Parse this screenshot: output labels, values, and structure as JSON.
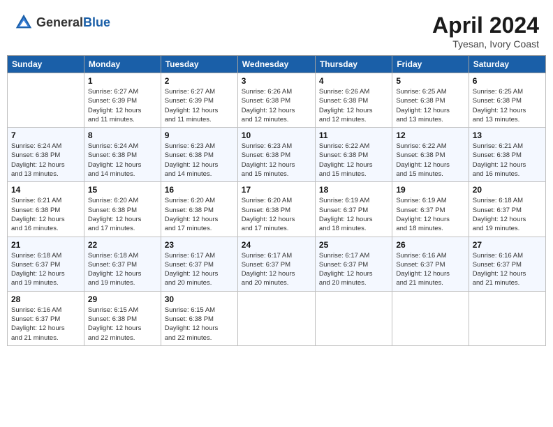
{
  "header": {
    "logo_general": "General",
    "logo_blue": "Blue",
    "month_title": "April 2024",
    "subtitle": "Tyesan, Ivory Coast"
  },
  "days_of_week": [
    "Sunday",
    "Monday",
    "Tuesday",
    "Wednesday",
    "Thursday",
    "Friday",
    "Saturday"
  ],
  "weeks": [
    [
      {
        "day": "",
        "info": ""
      },
      {
        "day": "1",
        "info": "Sunrise: 6:27 AM\nSunset: 6:39 PM\nDaylight: 12 hours\nand 11 minutes."
      },
      {
        "day": "2",
        "info": "Sunrise: 6:27 AM\nSunset: 6:39 PM\nDaylight: 12 hours\nand 11 minutes."
      },
      {
        "day": "3",
        "info": "Sunrise: 6:26 AM\nSunset: 6:38 PM\nDaylight: 12 hours\nand 12 minutes."
      },
      {
        "day": "4",
        "info": "Sunrise: 6:26 AM\nSunset: 6:38 PM\nDaylight: 12 hours\nand 12 minutes."
      },
      {
        "day": "5",
        "info": "Sunrise: 6:25 AM\nSunset: 6:38 PM\nDaylight: 12 hours\nand 13 minutes."
      },
      {
        "day": "6",
        "info": "Sunrise: 6:25 AM\nSunset: 6:38 PM\nDaylight: 12 hours\nand 13 minutes."
      }
    ],
    [
      {
        "day": "7",
        "info": "Sunrise: 6:24 AM\nSunset: 6:38 PM\nDaylight: 12 hours\nand 13 minutes."
      },
      {
        "day": "8",
        "info": "Sunrise: 6:24 AM\nSunset: 6:38 PM\nDaylight: 12 hours\nand 14 minutes."
      },
      {
        "day": "9",
        "info": "Sunrise: 6:23 AM\nSunset: 6:38 PM\nDaylight: 12 hours\nand 14 minutes."
      },
      {
        "day": "10",
        "info": "Sunrise: 6:23 AM\nSunset: 6:38 PM\nDaylight: 12 hours\nand 15 minutes."
      },
      {
        "day": "11",
        "info": "Sunrise: 6:22 AM\nSunset: 6:38 PM\nDaylight: 12 hours\nand 15 minutes."
      },
      {
        "day": "12",
        "info": "Sunrise: 6:22 AM\nSunset: 6:38 PM\nDaylight: 12 hours\nand 15 minutes."
      },
      {
        "day": "13",
        "info": "Sunrise: 6:21 AM\nSunset: 6:38 PM\nDaylight: 12 hours\nand 16 minutes."
      }
    ],
    [
      {
        "day": "14",
        "info": "Sunrise: 6:21 AM\nSunset: 6:38 PM\nDaylight: 12 hours\nand 16 minutes."
      },
      {
        "day": "15",
        "info": "Sunrise: 6:20 AM\nSunset: 6:38 PM\nDaylight: 12 hours\nand 17 minutes."
      },
      {
        "day": "16",
        "info": "Sunrise: 6:20 AM\nSunset: 6:38 PM\nDaylight: 12 hours\nand 17 minutes."
      },
      {
        "day": "17",
        "info": "Sunrise: 6:20 AM\nSunset: 6:38 PM\nDaylight: 12 hours\nand 17 minutes."
      },
      {
        "day": "18",
        "info": "Sunrise: 6:19 AM\nSunset: 6:37 PM\nDaylight: 12 hours\nand 18 minutes."
      },
      {
        "day": "19",
        "info": "Sunrise: 6:19 AM\nSunset: 6:37 PM\nDaylight: 12 hours\nand 18 minutes."
      },
      {
        "day": "20",
        "info": "Sunrise: 6:18 AM\nSunset: 6:37 PM\nDaylight: 12 hours\nand 19 minutes."
      }
    ],
    [
      {
        "day": "21",
        "info": "Sunrise: 6:18 AM\nSunset: 6:37 PM\nDaylight: 12 hours\nand 19 minutes."
      },
      {
        "day": "22",
        "info": "Sunrise: 6:18 AM\nSunset: 6:37 PM\nDaylight: 12 hours\nand 19 minutes."
      },
      {
        "day": "23",
        "info": "Sunrise: 6:17 AM\nSunset: 6:37 PM\nDaylight: 12 hours\nand 20 minutes."
      },
      {
        "day": "24",
        "info": "Sunrise: 6:17 AM\nSunset: 6:37 PM\nDaylight: 12 hours\nand 20 minutes."
      },
      {
        "day": "25",
        "info": "Sunrise: 6:17 AM\nSunset: 6:37 PM\nDaylight: 12 hours\nand 20 minutes."
      },
      {
        "day": "26",
        "info": "Sunrise: 6:16 AM\nSunset: 6:37 PM\nDaylight: 12 hours\nand 21 minutes."
      },
      {
        "day": "27",
        "info": "Sunrise: 6:16 AM\nSunset: 6:37 PM\nDaylight: 12 hours\nand 21 minutes."
      }
    ],
    [
      {
        "day": "28",
        "info": "Sunrise: 6:16 AM\nSunset: 6:37 PM\nDaylight: 12 hours\nand 21 minutes."
      },
      {
        "day": "29",
        "info": "Sunrise: 6:15 AM\nSunset: 6:38 PM\nDaylight: 12 hours\nand 22 minutes."
      },
      {
        "day": "30",
        "info": "Sunrise: 6:15 AM\nSunset: 6:38 PM\nDaylight: 12 hours\nand 22 minutes."
      },
      {
        "day": "",
        "info": ""
      },
      {
        "day": "",
        "info": ""
      },
      {
        "day": "",
        "info": ""
      },
      {
        "day": "",
        "info": ""
      }
    ]
  ]
}
